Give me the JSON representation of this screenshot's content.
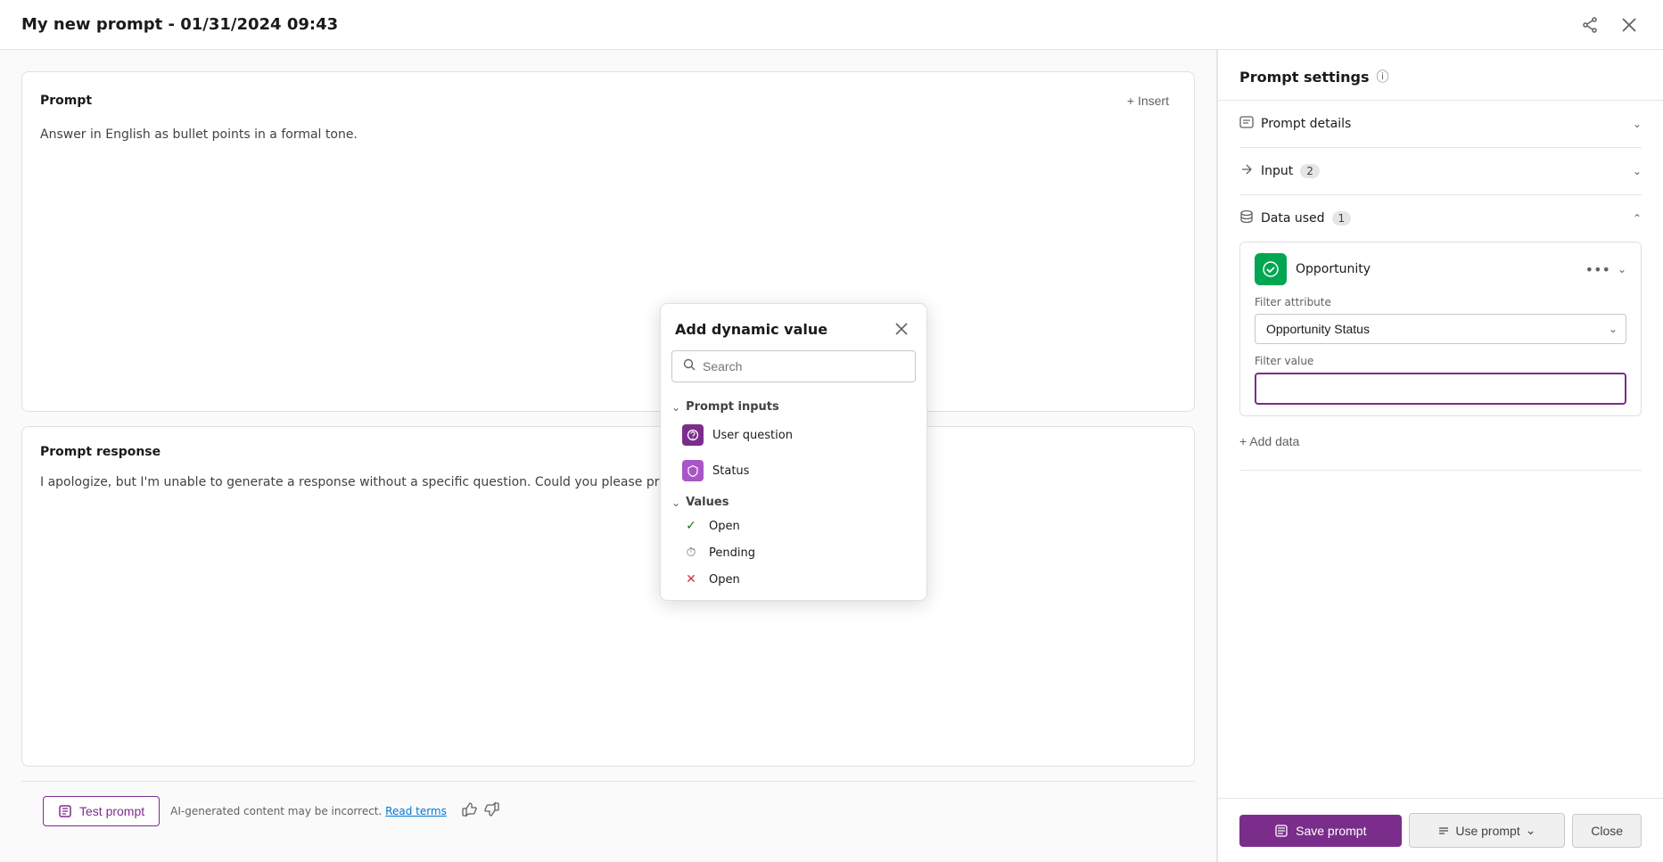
{
  "window": {
    "title": "My new prompt - 01/31/2024 09:43"
  },
  "prompt_card": {
    "header": "Prompt",
    "insert_label": "+ Insert",
    "content": "Answer in English as bullet points in a formal tone."
  },
  "response_card": {
    "header": "Prompt response",
    "content": "I apologize, but I'm unable to generate a response without a specific question. Could you please provide more de"
  },
  "bottom_bar": {
    "test_prompt_label": "Test prompt",
    "disclaimer": "AI-generated content may be incorrect.",
    "read_terms": "Read terms"
  },
  "prompt_settings": {
    "title": "Prompt settings",
    "sections": {
      "prompt_details": {
        "label": "Prompt details"
      },
      "input": {
        "label": "Input",
        "badge": "2"
      },
      "data_used": {
        "label": "Data used",
        "badge": "1"
      }
    },
    "opportunity": {
      "name": "Opportunity",
      "filter_attribute_label": "Filter attribute",
      "filter_attribute_value": "Opportunity Status",
      "filter_value_label": "Filter value",
      "filter_value_placeholder": ""
    },
    "add_data_label": "+ Add data"
  },
  "footer": {
    "save_prompt_label": "Save prompt",
    "use_prompt_label": "Use prompt",
    "close_label": "Close"
  },
  "dynamic_popup": {
    "title": "Add dynamic value",
    "search_placeholder": "Search",
    "sections": {
      "prompt_inputs": {
        "label": "Prompt inputs",
        "items": [
          {
            "label": "User question",
            "icon": "star"
          },
          {
            "label": "Status",
            "icon": "shield"
          }
        ]
      },
      "values": {
        "label": "Values",
        "items": [
          {
            "label": "Open",
            "icon": "check"
          },
          {
            "label": "Pending",
            "icon": "clock"
          },
          {
            "label": "Open",
            "icon": "x"
          }
        ]
      }
    }
  }
}
